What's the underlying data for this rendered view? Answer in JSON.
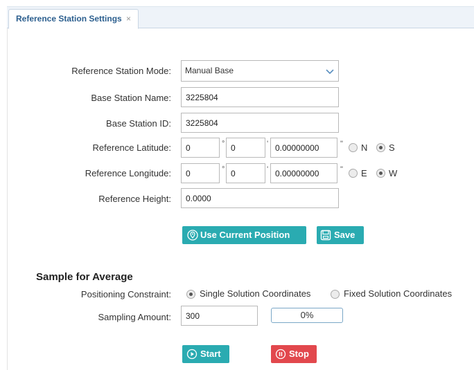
{
  "tab": {
    "title": "Reference Station Settings",
    "close": "×"
  },
  "form": {
    "mode_label": "Reference Station Mode:",
    "mode_value": "Manual Base",
    "name_label": "Base Station Name:",
    "name_value": "3225804",
    "id_label": "Base Station ID:",
    "id_value": "3225804",
    "lat_label": "Reference Latitude:",
    "lat_deg": "0",
    "lat_min": "0",
    "lat_sec": "0.00000000",
    "lon_label": "Reference Longitude:",
    "lon_deg": "0",
    "lon_min": "0",
    "lon_sec": "0.00000000",
    "height_label": "Reference Height:",
    "height_value": "0.0000",
    "deg_symbol": "°",
    "min_symbol": "'",
    "sec_symbol": "\"",
    "north": "N",
    "south": "S",
    "east": "E",
    "west": "W",
    "lat_hemisphere": "S",
    "lon_hemisphere": "W"
  },
  "buttons": {
    "use_current": "Use Current Position",
    "save": "Save",
    "start": "Start",
    "stop": "Stop"
  },
  "sample": {
    "title": "Sample for Average",
    "constraint_label": "Positioning Constraint:",
    "single": "Single Solution Coordinates",
    "fixed": "Fixed Solution Coordinates",
    "selected_constraint": "single",
    "amount_label": "Sampling Amount:",
    "amount_value": "300",
    "progress_text": "0%",
    "progress_fraction": 0
  },
  "colors": {
    "accent": "#2aabb1",
    "danger": "#e2484d",
    "tab_text": "#2b5e8e"
  },
  "icons": {
    "use_current": "location-pin-icon",
    "save": "floppy-disk-icon",
    "start": "play-circle-icon",
    "stop": "pause-circle-icon",
    "dropdown": "chevron-down-icon"
  }
}
